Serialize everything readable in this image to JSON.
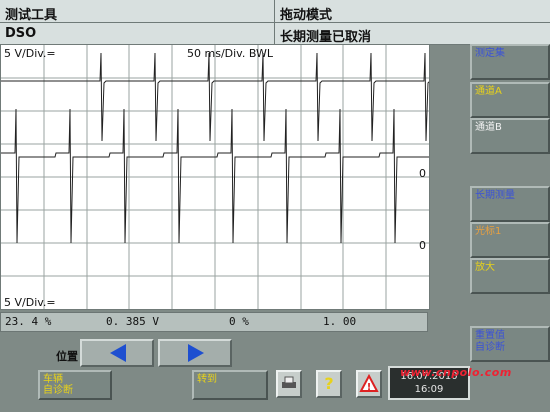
{
  "header": {
    "title_left": "测试工具",
    "mode_label": "拖动模式",
    "subtitle_left": "DSO",
    "status_right": "长期测量已取消"
  },
  "scope": {
    "scale_top": "5 V/Div.=",
    "timebase": "50 ms/Div. BWL",
    "scale_bottom": "5 V/Div.=",
    "zero_marker_a": "0",
    "zero_marker_b": "0"
  },
  "readout": {
    "duty": "23. 4  %",
    "voltage": "0. 385  V",
    "percent": "0  %",
    "ratio": "1. 00"
  },
  "sidebar": {
    "setup_label": "测定集",
    "channel_a_label": "通道A",
    "channel_b_label": "通道B",
    "trigger_label": "长期测量",
    "cursor_label": "光标1",
    "zoom_label": "放大",
    "reset_label": "重置值\n自诊断"
  },
  "position": {
    "label": "位置"
  },
  "bottom": {
    "vehicle_diag_label": "车辆\n自诊断",
    "goto_label": "转到",
    "help_glyph": "?",
    "warning_glyph": "!"
  },
  "clock": {
    "date": "16.07.2010",
    "time": "16:09"
  },
  "watermark": {
    "text": "www.cnpolo.com"
  },
  "colors": {
    "header_bg": "#d8e0df",
    "panel_bg": "#7f8a86",
    "arrow_blue": "#1e4fd0"
  }
}
